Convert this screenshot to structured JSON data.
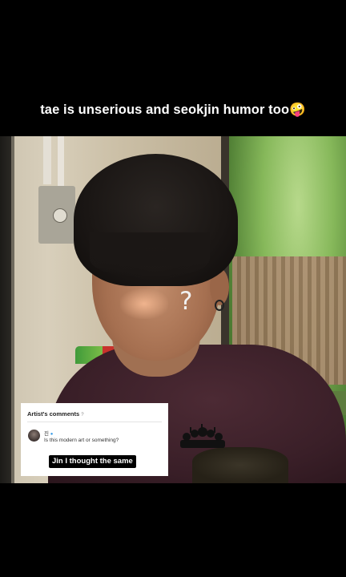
{
  "caption": {
    "text": "tae is unserious and seokjin humor too🤪"
  },
  "video": {
    "overlay_mark": "?"
  },
  "comment_card": {
    "title": "Artist's comments",
    "title_info": "?",
    "user_name": "진",
    "verified": "●",
    "comment": "Is this modern art or something?"
  },
  "subtitle": {
    "text": "Jin I thought the same"
  }
}
